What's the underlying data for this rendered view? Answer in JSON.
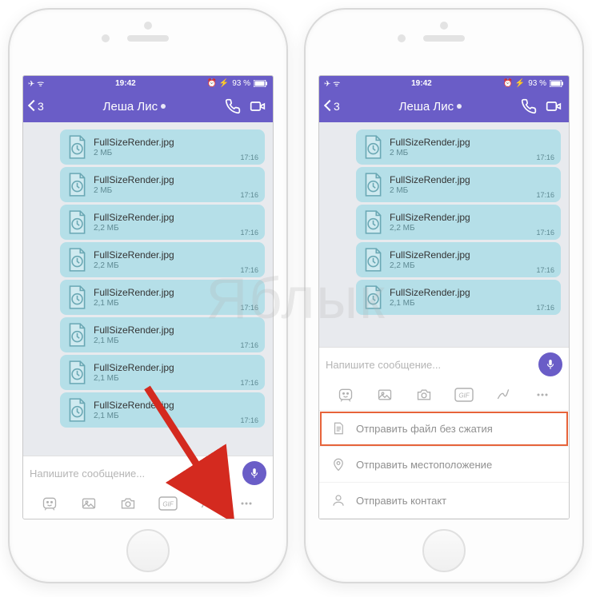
{
  "watermark": "Яблык",
  "status": {
    "time": "19:42",
    "battery": "93 %",
    "carrier_icons": "✈ ᯤ",
    "right_icons": "⏰ ⚡"
  },
  "nav": {
    "back_count": "3",
    "title": "Леша Лис"
  },
  "messages_left": [
    {
      "name": "FullSizeRender.jpg",
      "size": "2 МБ",
      "time": "17:16"
    },
    {
      "name": "FullSizeRender.jpg",
      "size": "2 МБ",
      "time": "17:16"
    },
    {
      "name": "FullSizeRender.jpg",
      "size": "2,2 МБ",
      "time": "17:16"
    },
    {
      "name": "FullSizeRender.jpg",
      "size": "2,2 МБ",
      "time": "17:16"
    },
    {
      "name": "FullSizeRender.jpg",
      "size": "2,1 МБ",
      "time": "17:16"
    },
    {
      "name": "FullSizeRender.jpg",
      "size": "2,1 МБ",
      "time": "17:16"
    },
    {
      "name": "FullSizeRender.jpg",
      "size": "2,1 МБ",
      "time": "17:16"
    },
    {
      "name": "FullSizeRender.jpg",
      "size": "2,1 МБ",
      "time": "17:16"
    }
  ],
  "messages_right": [
    {
      "name": "FullSizeRender.jpg",
      "size": "2 МБ",
      "time": "17:16"
    },
    {
      "name": "FullSizeRender.jpg",
      "size": "2 МБ",
      "time": "17:16"
    },
    {
      "name": "FullSizeRender.jpg",
      "size": "2,2 МБ",
      "time": "17:16"
    },
    {
      "name": "FullSizeRender.jpg",
      "size": "2,2 МБ",
      "time": "17:16"
    },
    {
      "name": "FullSizeRender.jpg",
      "size": "2,1 МБ",
      "time": "17:16"
    }
  ],
  "composer": {
    "placeholder": "Напишите сообщение..."
  },
  "menu": {
    "send_file": "Отправить файл без сжатия",
    "send_location": "Отправить местоположение",
    "send_contact": "Отправить контакт"
  }
}
